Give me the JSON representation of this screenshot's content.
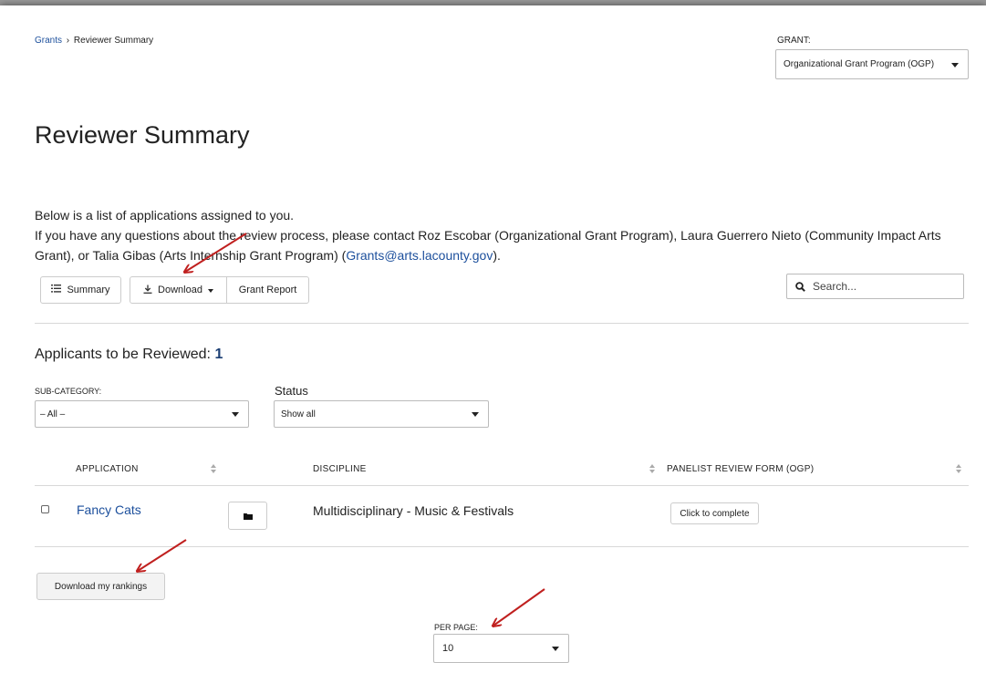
{
  "breadcrumb": {
    "root": "Grants",
    "separator": "›",
    "current": "Reviewer Summary"
  },
  "grant_selector": {
    "label": "GRANT:",
    "selected": "Organizational Grant Program (OGP)"
  },
  "page_title": "Reviewer Summary",
  "intro": {
    "line1": "Below is a list of applications assigned to you.",
    "line2_prefix": "If you have any questions about the review process, please contact Roz Escobar (Organizational Grant Program), Laura Guerrero Nieto (Community Impact Arts Grant), or Talia Gibas (Arts Internship Grant Program) (",
    "email": "Grants@arts.lacounty.gov",
    "line2_suffix": ")."
  },
  "toolbar": {
    "summary_label": "Summary",
    "download_label": "Download",
    "grant_report_label": "Grant Report",
    "search_placeholder": "Search..."
  },
  "applicants": {
    "label": "Applicants to be Reviewed: ",
    "count": "1"
  },
  "filters": {
    "subcategory_label": "SUB-CATEGORY:",
    "subcategory_value": "– All –",
    "status_label": "Status",
    "status_value": "Show all"
  },
  "table": {
    "headers": {
      "application": "APPLICATION",
      "discipline": "DISCIPLINE",
      "review_form": "PANELIST REVIEW FORM (OGP)"
    },
    "rows": [
      {
        "application": "Fancy Cats",
        "discipline": "Multidisciplinary - Music & Festivals",
        "action": "Click to complete"
      }
    ]
  },
  "rankings_button": "Download my rankings",
  "pagination": {
    "per_page_label": "PER PAGE:",
    "per_page_value": "10"
  },
  "colors": {
    "link": "#1c4f9c",
    "annotation_arrow": "#c0201f"
  }
}
